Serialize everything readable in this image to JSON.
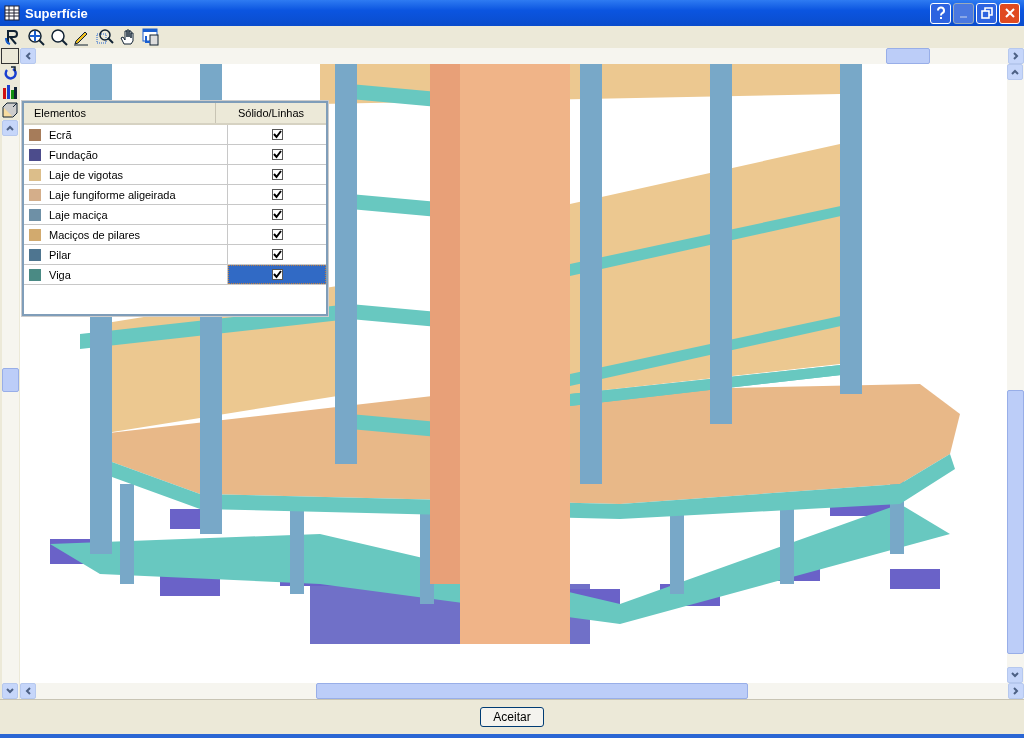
{
  "window": {
    "title": "Superfície"
  },
  "legend": {
    "columns": [
      "Elementos",
      "Sólido/Linhas"
    ],
    "rows": [
      {
        "name": "Ecrã",
        "color": "#a67c5a",
        "checked": true,
        "selected": false
      },
      {
        "name": "Fundação",
        "color": "#4c4c8c",
        "checked": true,
        "selected": false
      },
      {
        "name": "Laje de vigotas",
        "color": "#dcbe8a",
        "checked": true,
        "selected": false
      },
      {
        "name": "Laje fungiforme aligeirada",
        "color": "#d4ae8a",
        "checked": true,
        "selected": false
      },
      {
        "name": "Laje maciça",
        "color": "#6e90a6",
        "checked": true,
        "selected": false
      },
      {
        "name": "Maciços de pilares",
        "color": "#d2aa6e",
        "checked": true,
        "selected": false
      },
      {
        "name": "Pilar",
        "color": "#4e7590",
        "checked": true,
        "selected": false
      },
      {
        "name": "Viga",
        "color": "#4a8a84",
        "checked": true,
        "selected": true
      }
    ]
  },
  "buttons": [
    "Aceitar"
  ]
}
